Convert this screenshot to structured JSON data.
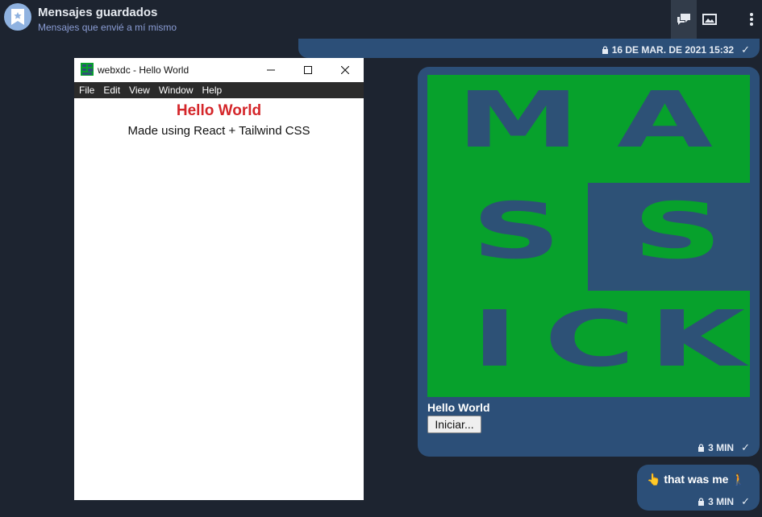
{
  "header": {
    "title": "Mensajes guardados",
    "subtitle": "Mensajes que envié a mí mismo"
  },
  "messages": [
    {
      "timestamp": "16 DE MAR. DE 2021 15:32"
    },
    {
      "image_letters": [
        "M",
        "A",
        "S",
        "S",
        "I",
        "C",
        "K"
      ],
      "caption": "Hello World",
      "button": "Iniciar...",
      "timestamp": "3 MIN"
    },
    {
      "text": "👆 that was me 🚶",
      "timestamp": "3 MIN"
    }
  ],
  "window": {
    "title": "webxdc - Hello World",
    "menu": [
      "File",
      "Edit",
      "View",
      "Window",
      "Help"
    ],
    "heading": "Hello World",
    "subheading": "Made using React + Tailwind CSS"
  },
  "colors": {
    "background": "#1d2430",
    "bubble": "#2c4f78",
    "image_green": "#07a12c",
    "image_blue": "#2d5176",
    "heading_red": "#d4262a"
  }
}
